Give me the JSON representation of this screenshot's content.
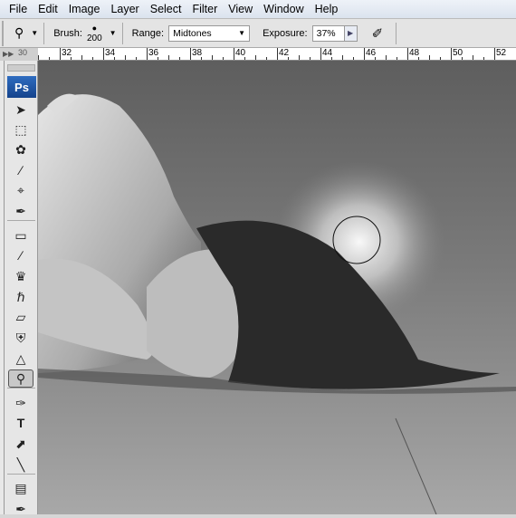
{
  "menu": [
    "File",
    "Edit",
    "Image",
    "Layer",
    "Select",
    "Filter",
    "View",
    "Window",
    "Help"
  ],
  "options": {
    "tool_icon": "burn-tool-icon",
    "brush_label": "Brush:",
    "brush_size": "200",
    "range_label": "Range:",
    "range_value": "Midtones",
    "exposure_label": "Exposure:",
    "exposure_value": "37%",
    "airbrush_icon": "airbrush-icon"
  },
  "ruler": {
    "corner": "30",
    "labels": [
      "32",
      "34",
      "36",
      "38",
      "40",
      "42",
      "44",
      "46",
      "48",
      "50",
      "52"
    ]
  },
  "toolbox": {
    "logo": "Ps",
    "tools": [
      "move",
      "marquee",
      "lasso",
      "quick-selection",
      "crop",
      "eyedropper",
      "healing-brush",
      "brush",
      "clone-stamp",
      "history-brush",
      "eraser",
      "paint-bucket",
      "blur",
      "burn",
      "pen",
      "type",
      "path-selection",
      "line",
      "notes",
      "eyedropper-3d"
    ]
  },
  "colors": {
    "accent": "#1f56a8"
  }
}
